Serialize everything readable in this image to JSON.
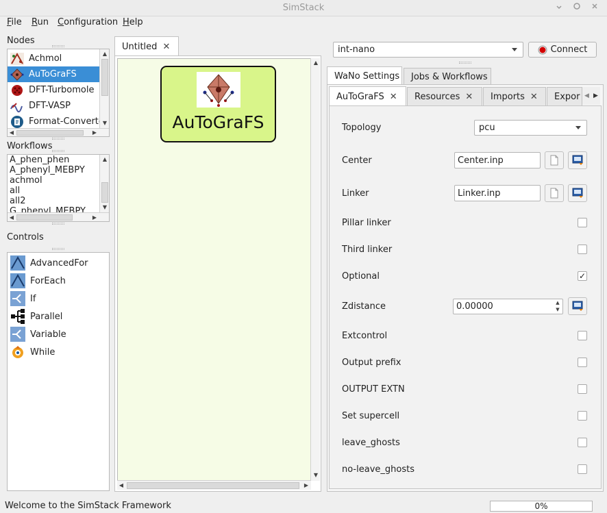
{
  "window": {
    "title": "SimStack"
  },
  "menu": {
    "file": {
      "underlined": "F",
      "rest": "ile"
    },
    "run": {
      "underlined": "R",
      "rest": "un"
    },
    "configuration": {
      "underlined": "C",
      "rest": "onfiguration"
    },
    "help": {
      "underlined": "H",
      "rest": "elp"
    }
  },
  "nodes": {
    "label": "Nodes",
    "items": [
      "Achmol",
      "AuToGraFS",
      "DFT-Turbomole",
      "DFT-VASP",
      "Format-Converter"
    ],
    "selected": "AuToGraFS"
  },
  "workflows": {
    "label": "Workflows",
    "items": [
      "A_phen_phen",
      "A_phenyl_MEBPY",
      "achmol",
      "all",
      "all2",
      "G_phenyl_MEBPY"
    ]
  },
  "controls": {
    "label": "Controls",
    "items": [
      "AdvancedFor",
      "ForEach",
      "If",
      "Parallel",
      "Variable",
      "While"
    ]
  },
  "editor": {
    "tab_label": "Untitled",
    "node_label": "AuToGraFS"
  },
  "server": {
    "selected": "int-nano",
    "connect_label": "Connect",
    "connect_status_color": "#d40000"
  },
  "right_tabs": {
    "outer": [
      "WaNo Settings",
      "Jobs & Workflows"
    ],
    "inner": [
      "AuToGraFS",
      "Resources",
      "Imports",
      "Expor"
    ]
  },
  "settings": {
    "topology": {
      "label": "Topology",
      "value": "pcu"
    },
    "center": {
      "label": "Center",
      "value": "Center.inp"
    },
    "linker": {
      "label": "Linker",
      "value": "Linker.inp"
    },
    "pillar_linker": {
      "label": "Pillar linker",
      "checked": false
    },
    "third_linker": {
      "label": "Third linker",
      "checked": false
    },
    "optional": {
      "label": "Optional",
      "checked": true
    },
    "zdistance": {
      "label": "Zdistance",
      "value": "0.00000"
    },
    "extcontrol": {
      "label": "Extcontrol",
      "checked": false
    },
    "output_prefix": {
      "label": "Output prefix",
      "checked": false
    },
    "output_extn": {
      "label": "OUTPUT EXTN",
      "checked": false
    },
    "set_supercell": {
      "label": "Set supercell",
      "checked": false
    },
    "leave_ghosts": {
      "label": "leave_ghosts",
      "checked": false
    },
    "no_leave_ghosts": {
      "label": "no-leave_ghosts",
      "checked": false
    }
  },
  "status": {
    "message": "Welcome to the SimStack Framework",
    "progress": "0%"
  },
  "colors": {
    "accent": "#3a8ed6",
    "node_fill": "#d9f58a",
    "canvas_bg": "#f6fce6"
  }
}
